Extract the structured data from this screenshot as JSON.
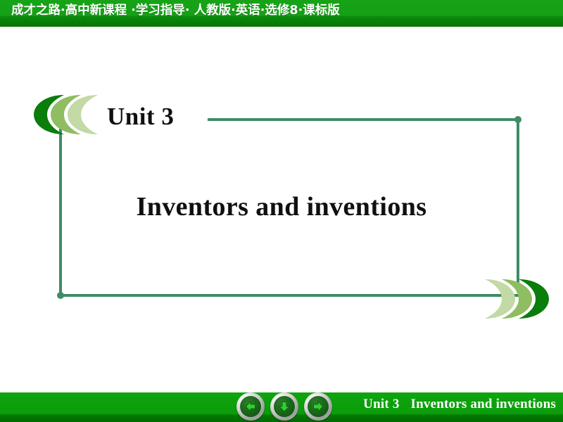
{
  "header": {
    "title": "成才之路·高中新课程 ·学习指导· 人教版·英语·选修8·课标版",
    "bg_color": "#15a015",
    "text_color": "#ffffff"
  },
  "content": {
    "unit_label": "Unit 3",
    "title": "Inventors and inventions",
    "frame_color": "#3f8c66",
    "decoration_colors": {
      "dark": "#0a7d0a",
      "medium": "#8ebd62",
      "light": "#c3d9a6"
    }
  },
  "footer": {
    "unit_label": "Unit 3",
    "title": "Inventors and inventions",
    "bg_color": "#0b9d0b",
    "text_color": "#ffffff",
    "nav": {
      "previous": "previous-slide",
      "down": "next-step",
      "next": "next-slide"
    }
  }
}
